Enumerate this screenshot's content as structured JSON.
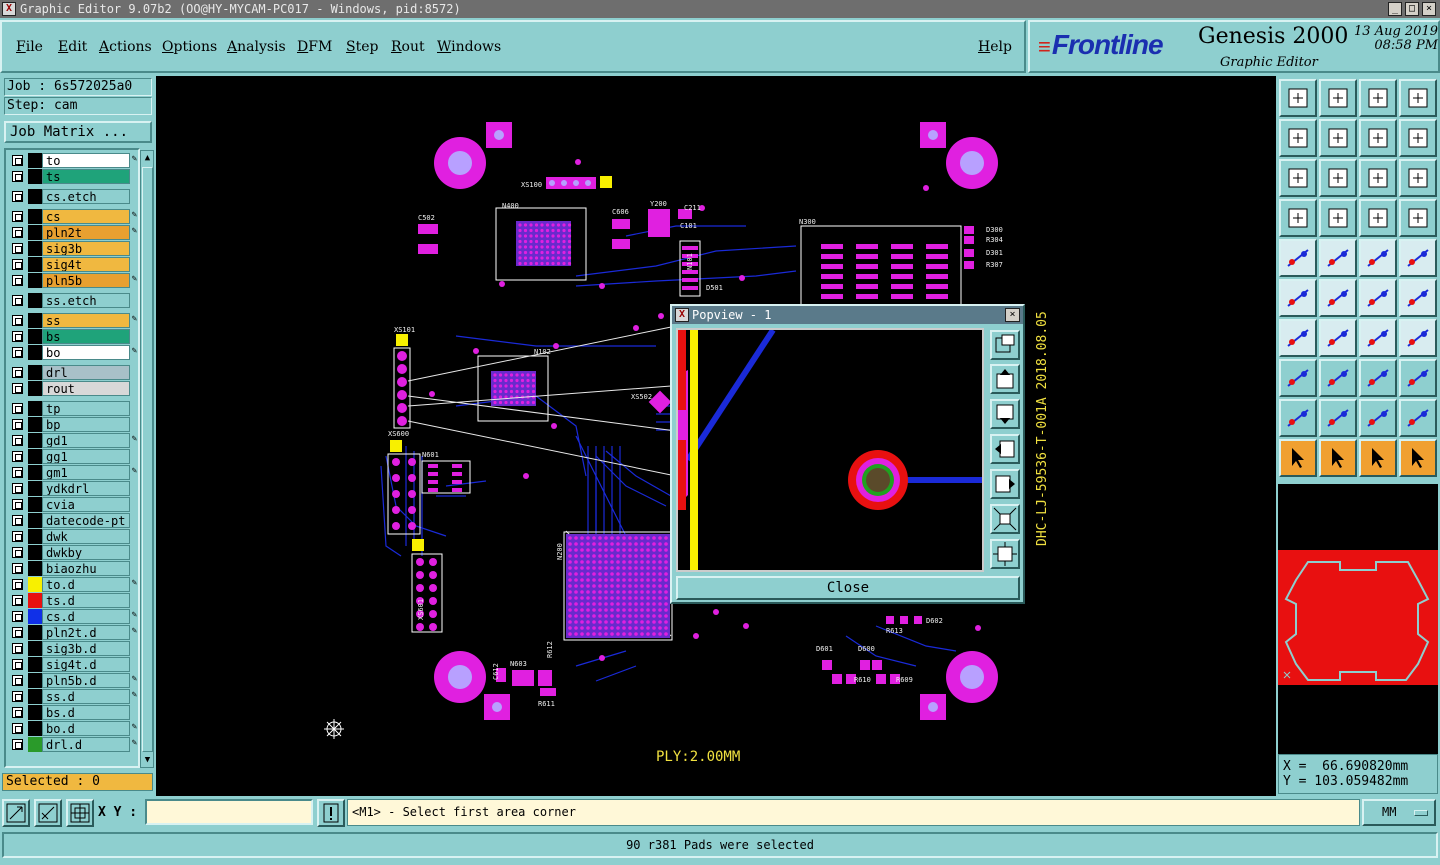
{
  "window": {
    "title": "Graphic Editor 9.07b2 (OO@HY-MYCAM-PC017 - Windows, pid:8572)"
  },
  "menu": [
    "File",
    "Edit",
    "Actions",
    "Options",
    "Analysis",
    "DFM",
    "Step",
    "Rout",
    "Windows"
  ],
  "help": "Help",
  "brand": {
    "logo": "Frontline",
    "product": "Genesis 2000",
    "subtitle": "Graphic Editor",
    "date": "13 Aug 2019",
    "time": "08:58 PM"
  },
  "job": {
    "job_line": "Job : 6s572025a0",
    "step_line": "Step: cam",
    "matrix_label": "Job Matrix ..."
  },
  "layers": [
    {
      "name": "to",
      "bg": "#ffffff",
      "swatch": "#000000",
      "edit": true
    },
    {
      "name": "ts",
      "bg": "#1fa37a",
      "swatch": "#000000",
      "edit": false
    },
    {
      "name": "cs.etch",
      "bg": "#8ecfcf",
      "swatch": "#000000",
      "edit": false
    },
    {
      "name": "cs",
      "bg": "#f0b840",
      "swatch": "#000000",
      "edit": true
    },
    {
      "name": "pln2t",
      "bg": "#e8a030",
      "swatch": "#000000",
      "edit": true
    },
    {
      "name": "sig3b",
      "bg": "#f0b840",
      "swatch": "#000000",
      "edit": false
    },
    {
      "name": "sig4t",
      "bg": "#f0b840",
      "swatch": "#000000",
      "edit": false
    },
    {
      "name": "pln5b",
      "bg": "#e8a030",
      "swatch": "#000000",
      "edit": true
    },
    {
      "name": "ss.etch",
      "bg": "#8ecfcf",
      "swatch": "#000000",
      "edit": false
    },
    {
      "name": "ss",
      "bg": "#f0b840",
      "swatch": "#000000",
      "edit": true
    },
    {
      "name": "bs",
      "bg": "#1fa37a",
      "swatch": "#000000",
      "edit": false
    },
    {
      "name": "bo",
      "bg": "#ffffff",
      "swatch": "#000000",
      "edit": true
    },
    {
      "name": "drl",
      "bg": "#a8c0c8",
      "swatch": "#000000",
      "edit": false
    },
    {
      "name": "rout",
      "bg": "#d8d8d8",
      "swatch": "#000000",
      "edit": false
    },
    {
      "name": "tp",
      "bg": "#8ecfcf",
      "swatch": "#000000",
      "edit": false
    },
    {
      "name": "bp",
      "bg": "#8ecfcf",
      "swatch": "#000000",
      "edit": false
    },
    {
      "name": "gd1",
      "bg": "#8ecfcf",
      "swatch": "#000000",
      "edit": true
    },
    {
      "name": "gg1",
      "bg": "#8ecfcf",
      "swatch": "#000000",
      "edit": false
    },
    {
      "name": "gm1",
      "bg": "#8ecfcf",
      "swatch": "#000000",
      "edit": true
    },
    {
      "name": "ydkdrl",
      "bg": "#8ecfcf",
      "swatch": "#000000",
      "edit": false
    },
    {
      "name": "cvia",
      "bg": "#8ecfcf",
      "swatch": "#000000",
      "edit": false
    },
    {
      "name": "datecode-pt",
      "bg": "#8ecfcf",
      "swatch": "#000000",
      "edit": false
    },
    {
      "name": "dwk",
      "bg": "#8ecfcf",
      "swatch": "#000000",
      "edit": false
    },
    {
      "name": "dwkby",
      "bg": "#8ecfcf",
      "swatch": "#000000",
      "edit": false
    },
    {
      "name": "biaozhu",
      "bg": "#8ecfcf",
      "swatch": "#000000",
      "edit": false
    },
    {
      "name": "to.d",
      "bg": "#8ecfcf",
      "swatch": "#f8f000",
      "edit": true
    },
    {
      "name": "ts.d",
      "bg": "#8ecfcf",
      "swatch": "#e81010",
      "edit": false
    },
    {
      "name": "cs.d",
      "bg": "#8ecfcf",
      "swatch": "#1030e8",
      "edit": true
    },
    {
      "name": "pln2t.d",
      "bg": "#8ecfcf",
      "swatch": "#000000",
      "edit": true
    },
    {
      "name": "sig3b.d",
      "bg": "#8ecfcf",
      "swatch": "#000000",
      "edit": false
    },
    {
      "name": "sig4t.d",
      "bg": "#8ecfcf",
      "swatch": "#000000",
      "edit": false
    },
    {
      "name": "pln5b.d",
      "bg": "#8ecfcf",
      "swatch": "#000000",
      "edit": true
    },
    {
      "name": "ss.d",
      "bg": "#8ecfcf",
      "swatch": "#000000",
      "edit": true
    },
    {
      "name": "bs.d",
      "bg": "#8ecfcf",
      "swatch": "#000000",
      "edit": false
    },
    {
      "name": "bo.d",
      "bg": "#8ecfcf",
      "swatch": "#000000",
      "edit": true
    },
    {
      "name": "drl.d",
      "bg": "#8ecfcf",
      "swatch": "#2a9a2a",
      "edit": true
    }
  ],
  "selected": "Selected : 0",
  "board_labels": {
    "ply": "PLY:2.00MM",
    "part_number": "DHC-LJ-59536-T-001A  2018.08.05",
    "refs": [
      "XS100",
      "N400",
      "C502",
      "C606",
      "Y200",
      "C211",
      "C101",
      "N300",
      "D300",
      "R304",
      "D301",
      "R307",
      "XS101",
      "N102",
      "XS502",
      "XS600",
      "N601",
      "N200",
      "XS601",
      "N603",
      "R612",
      "C612",
      "R611",
      "D601",
      "D600",
      "R610",
      "R609",
      "R613",
      "D602",
      "D501",
      "N101"
    ]
  },
  "popview": {
    "title": "Popview - 1",
    "close_label": "Close"
  },
  "coords": {
    "x": "X =  66.690820mm",
    "y": "Y = 103.059482mm"
  },
  "bottom": {
    "xy_label": "X Y :",
    "xy_value": "",
    "prompt": "<M1> - Select first area corner",
    "units": "MM"
  },
  "status": "90 r381 Pads were selected"
}
